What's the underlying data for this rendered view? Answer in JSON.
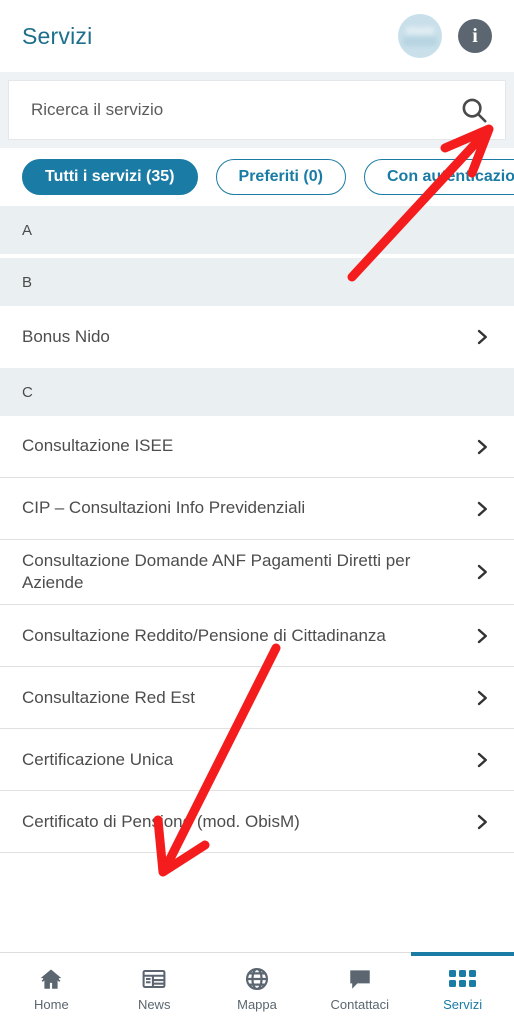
{
  "header": {
    "title": "Servizi",
    "avatar_name": "avatar",
    "info_glyph": "i"
  },
  "search": {
    "placeholder": "Ricerca il servizio",
    "value": "",
    "icon": "search-icon"
  },
  "filters": [
    {
      "label": "Tutti i servizi (35)",
      "state": "active"
    },
    {
      "label": "Preferiti (0)",
      "state": "idle"
    },
    {
      "label": "Con autenticazione",
      "state": "idle"
    }
  ],
  "list": {
    "sections": [
      {
        "letter": "A",
        "items": []
      },
      {
        "letter": "B",
        "items": [
          {
            "label": "Bonus Nido"
          }
        ]
      },
      {
        "letter": "C",
        "items": [
          {
            "label": "Consultazione ISEE"
          },
          {
            "label": "CIP – Consultazioni Info Previdenziali"
          },
          {
            "label": "Consultazione Domande ANF Pagamenti Diretti per Aziende"
          },
          {
            "label": "Consultazione Reddito/Pensione di Cittadinanza"
          },
          {
            "label": "Consultazione Red Est"
          },
          {
            "label": "Certificazione Unica"
          },
          {
            "label": "Certificato di Pensione (mod. ObisM)"
          }
        ]
      }
    ],
    "chevron_icon": "chevron-right-icon"
  },
  "bottom_nav": [
    {
      "label": "Home",
      "icon": "home-icon",
      "active": false
    },
    {
      "label": "News",
      "icon": "news-icon",
      "active": false
    },
    {
      "label": "Mappa",
      "icon": "globe-icon",
      "active": false
    },
    {
      "label": "Contattaci",
      "icon": "chat-bubble-icon",
      "active": false
    },
    {
      "label": "Servizi",
      "icon": "grid-icon",
      "active": true
    }
  ],
  "colors": {
    "brand_teal": "#1a7ba4",
    "title_teal": "#1d6f8b",
    "section_bg": "#eaf0f2",
    "strip_bg": "#eef2f4",
    "text_gray": "#4d4d4d",
    "icon_gray": "#5b6670",
    "annotation_red": "#f41c1c"
  },
  "annotations": [
    {
      "name": "arrow-to-search-icon",
      "color": "#f41c1c"
    },
    {
      "name": "arrow-to-certificazione-unica",
      "color": "#f41c1c"
    }
  ]
}
